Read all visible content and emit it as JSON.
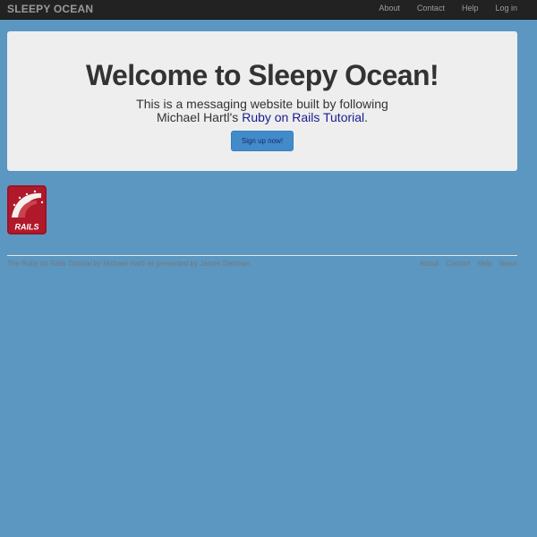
{
  "header": {
    "brand": "SLEEPY OCEAN",
    "nav": [
      "About",
      "Contact",
      "Help",
      "Log in"
    ]
  },
  "hero": {
    "title": "Welcome to Sleepy Ocean!",
    "line1": "This is a messaging website built by following",
    "line2_prefix": "Michael Hartl's ",
    "line2_link": "Ruby on Rails Tutorial",
    "line2_suffix": ".",
    "signup_button": "Sign up now!"
  },
  "logo": {
    "icon": "rails-logo-icon",
    "text": "RAILS"
  },
  "footer": {
    "credit": "The Ruby on Rails Tutorial by Michael Hartl as presented by James Denman",
    "links": [
      "About",
      "Contact",
      "Help",
      "News"
    ]
  },
  "colors": {
    "background": "#5b97c0",
    "navbar": "#222222",
    "jumbotron": "#eeeeee",
    "button": "#428bca",
    "link": "#1a1c8f",
    "logo_red": "#b0192a"
  }
}
